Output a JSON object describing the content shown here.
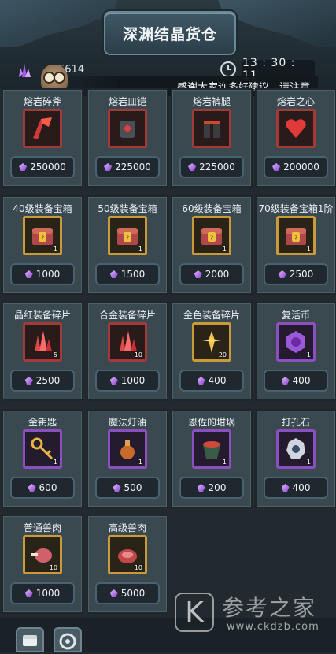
{
  "header": {
    "title": "深渊结晶货仓",
    "currency_value": "6614",
    "time": "13 : 30 : 11",
    "notice": "感谢大家许多好建议，请注意"
  },
  "items": [
    {
      "name": "熔岩碎斧",
      "price": "250000",
      "qty": "",
      "frame": "red",
      "icon": "lava-axe-icon"
    },
    {
      "name": "熔岩皿铠",
      "price": "225000",
      "qty": "",
      "frame": "red",
      "icon": "lava-armor-icon"
    },
    {
      "name": "熔岩裤腿",
      "price": "225000",
      "qty": "",
      "frame": "red",
      "icon": "lava-leggings-icon"
    },
    {
      "name": "熔岩之心",
      "price": "200000",
      "qty": "",
      "frame": "red",
      "icon": "lava-heart-icon"
    },
    {
      "name": "40级装备宝箱",
      "price": "1000",
      "qty": "1",
      "frame": "gold",
      "icon": "treasure-chest-icon"
    },
    {
      "name": "50级装备宝箱",
      "price": "1500",
      "qty": "1",
      "frame": "gold",
      "icon": "treasure-chest-icon"
    },
    {
      "name": "60级装备宝箱",
      "price": "2000",
      "qty": "1",
      "frame": "gold",
      "icon": "treasure-chest-icon"
    },
    {
      "name": "70级装备宝箱1阶",
      "price": "2500",
      "qty": "1",
      "frame": "gold",
      "icon": "treasure-chest-icon"
    },
    {
      "name": "晶红装备碎片",
      "price": "2500",
      "qty": "5",
      "frame": "red",
      "icon": "red-crystal-icon"
    },
    {
      "name": "合金装备碎片",
      "price": "1000",
      "qty": "10",
      "frame": "red",
      "icon": "red-crystal-icon"
    },
    {
      "name": "金色装备碎片",
      "price": "400",
      "qty": "20",
      "frame": "gold",
      "icon": "gold-crystal-icon"
    },
    {
      "name": "复活币",
      "price": "400",
      "qty": "1",
      "frame": "purple",
      "icon": "revive-coin-icon"
    },
    {
      "name": "金钥匙",
      "price": "600",
      "qty": "1",
      "frame": "purple",
      "icon": "gold-key-icon"
    },
    {
      "name": "魔法灯油",
      "price": "500",
      "qty": "1",
      "frame": "purple",
      "icon": "lamp-oil-icon"
    },
    {
      "name": "恩佐的坩埚",
      "price": "200",
      "qty": "1",
      "frame": "purple",
      "icon": "crucible-icon"
    },
    {
      "name": "打孔石",
      "price": "400",
      "qty": "1",
      "frame": "purple",
      "icon": "punch-stone-icon"
    },
    {
      "name": "普通兽肉",
      "price": "1000",
      "qty": "10",
      "frame": "gold",
      "icon": "meat-icon"
    },
    {
      "name": "高级兽肉",
      "price": "5000",
      "qty": "10",
      "frame": "gold",
      "icon": "premium-meat-icon"
    }
  ],
  "watermark": {
    "letter": "K",
    "text": "参考之家",
    "url": "www.ckdzb.com"
  },
  "colors": {
    "red_frame": "#a33a3a",
    "gold_frame": "#c99a3a",
    "purple_frame": "#8b4fc0",
    "gem": "#b46cf0"
  }
}
